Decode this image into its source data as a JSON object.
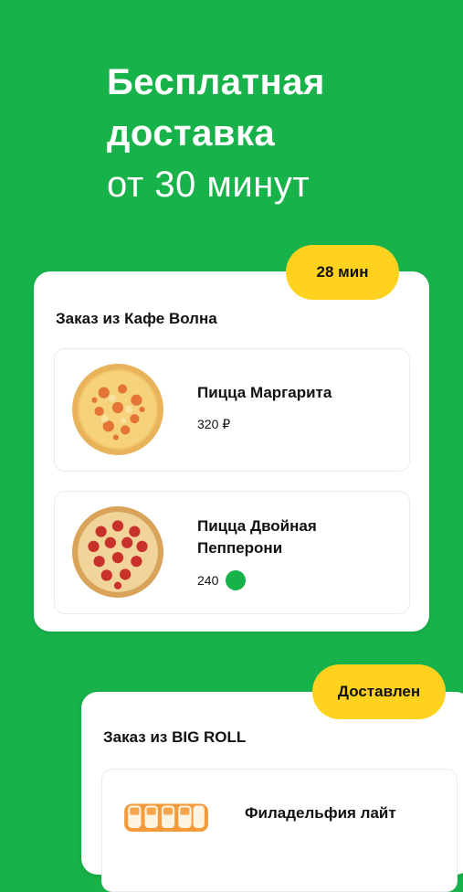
{
  "hero": {
    "line1": "Бесплатная",
    "line2": "доставка",
    "line3": "от 30 минут"
  },
  "orders": [
    {
      "badge": "28 мин",
      "title": "Заказ из Кафе Волна",
      "items": [
        {
          "name": "Пицца Маргарита",
          "price": "320 ₽",
          "icon": "pizza-margherita-image"
        },
        {
          "name": "Пицца Двойная Пепперони",
          "price": "240",
          "icon": "pizza-pepperoni-image"
        }
      ]
    },
    {
      "badge": "Доставлен",
      "title": "Заказ из BIG ROLL",
      "items": [
        {
          "name": "Филадельфия лайт",
          "icon": "sushi-roll-image"
        }
      ]
    }
  ],
  "colors": {
    "background": "#17b24a",
    "badge": "#ffd21f",
    "card": "#ffffff"
  }
}
